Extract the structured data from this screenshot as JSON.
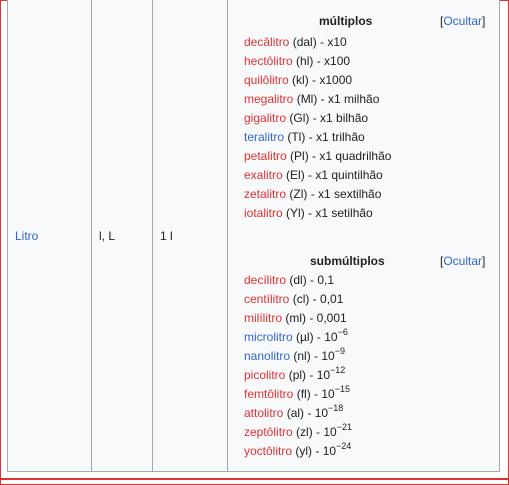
{
  "row": {
    "unit_name": "Litro",
    "symbols": "l, L",
    "equivalence": "1 l"
  },
  "multiples": {
    "title": "múltiplos",
    "toggle_open": "[",
    "toggle_label": "Ocultar",
    "toggle_close": "]",
    "items": [
      {
        "name": "decâlitro",
        "rest": " (dal) - x10",
        "color": "red"
      },
      {
        "name": "hectôlitro",
        "rest": " (hl) - x100",
        "color": "red"
      },
      {
        "name": "quilôlitro",
        "rest": " (kl) - x1000",
        "color": "red"
      },
      {
        "name": "megalitro",
        "rest": " (Ml) - x1 milhão",
        "color": "red"
      },
      {
        "name": "gigalitro",
        "rest": " (Gl) - x1 bilhão",
        "color": "red"
      },
      {
        "name": "teralitro",
        "rest": " (Tl) - x1 trilhão",
        "color": "blue"
      },
      {
        "name": "petalitro",
        "rest": " (Pl) - x1 quadrilhão",
        "color": "red"
      },
      {
        "name": "exalitro",
        "rest": " (El) - x1 quintilhão",
        "color": "red"
      },
      {
        "name": "zetalitro",
        "rest": " (Zl) - x1 sextilhão",
        "color": "red"
      },
      {
        "name": "iotalitro",
        "rest": " (Yl) - x1 setilhão",
        "color": "red"
      }
    ]
  },
  "submultiples": {
    "title": "submúltiplos",
    "toggle_open": "[",
    "toggle_label": "Ocultar",
    "toggle_close": "]",
    "items": [
      {
        "name": "decílitro",
        "rest": " (dl) - 0,1",
        "exp": "",
        "color": "red"
      },
      {
        "name": "centílitro",
        "rest": " (cl) - 0,01",
        "exp": "",
        "color": "red"
      },
      {
        "name": "milílitro",
        "rest": " (ml) - 0,001",
        "exp": "",
        "color": "red"
      },
      {
        "name": "microlitro",
        "rest": " (µl) - 10",
        "exp": "−6",
        "color": "blue"
      },
      {
        "name": "nanolitro",
        "rest": " (nl) - 10",
        "exp": "−9",
        "color": "blue"
      },
      {
        "name": "picolitro",
        "rest": " (pl) - 10",
        "exp": "−12",
        "color": "red"
      },
      {
        "name": "femtôlitro",
        "rest": " (fl) - 10",
        "exp": "−15",
        "color": "red"
      },
      {
        "name": "attolitro",
        "rest": " (al) - 10",
        "exp": "−18",
        "color": "red"
      },
      {
        "name": "zeptôlitro",
        "rest": " (zl) - 10",
        "exp": "−21",
        "color": "red"
      },
      {
        "name": "yoctôlitro",
        "rest": " (yl) - 10",
        "exp": "−24",
        "color": "red"
      }
    ]
  },
  "colors": {
    "red_link": "#dd3333",
    "blue_link": "#3366cc",
    "cell_border": "#a2a9b1",
    "frame": "#dd3333"
  }
}
